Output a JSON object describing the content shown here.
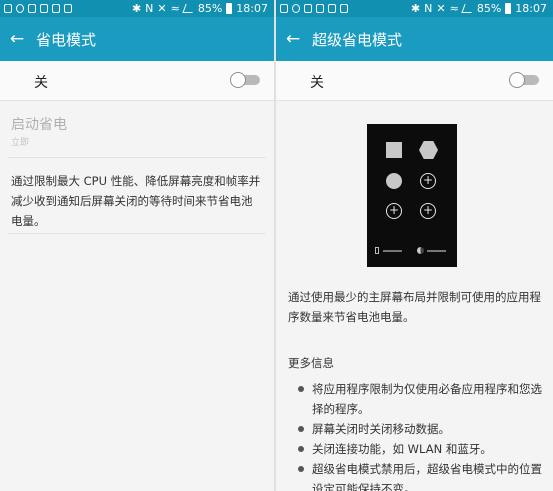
{
  "status_bar": {
    "battery": "85%",
    "time": "18:07"
  },
  "left_screen": {
    "title": "省电模式",
    "toggle": {
      "label": "关",
      "state": "off"
    },
    "start": {
      "title": "启动省电",
      "subtitle": "立即"
    },
    "description": "通过限制最大 CPU 性能、降低屏幕亮度和帧率并减少收到通知后屏幕关闭的等待时间来节省电池电量。"
  },
  "right_screen": {
    "title": "超级省电模式",
    "toggle": {
      "label": "关",
      "state": "off"
    },
    "description": "通过使用最少的主屏幕布局并限制可使用的应用程序数量来节省电池电量。",
    "more_info": {
      "title": "更多信息",
      "items": [
        "将应用程序限制为仅使用必备应用程序和您选择的程序。",
        "屏幕关闭时关闭移动数据。",
        "关闭连接功能，如 WLAN 和蓝牙。",
        "超级省电模式禁用后，超级省电模式中的位置设定可能保持不变。"
      ]
    }
  },
  "colors": {
    "app_bar": "#1a9cc1",
    "status_bar": "#1290b2"
  },
  "icons": {
    "back": "arrow-left-icon"
  }
}
